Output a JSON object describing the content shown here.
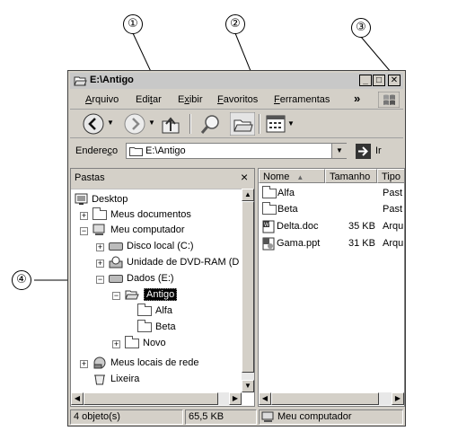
{
  "callouts": [
    "①",
    "②",
    "③",
    "④"
  ],
  "window": {
    "title": "E:\\Antigo",
    "controls": {
      "minimize": "_",
      "maximize": "□",
      "close": "✕"
    }
  },
  "menubar": {
    "items": [
      {
        "pre": "",
        "key": "A",
        "post": "rquivo"
      },
      {
        "pre": "Edi",
        "key": "t",
        "post": "ar"
      },
      {
        "pre": "E",
        "key": "x",
        "post": "ibir"
      },
      {
        "pre": "",
        "key": "F",
        "post": "avoritos"
      },
      {
        "pre": "",
        "key": "F",
        "post": "erramentas"
      }
    ],
    "overflow": "»"
  },
  "addressbar": {
    "label_pre": "Endere",
    "label_key": "ç",
    "label_post": "o",
    "value": "E:\\Antigo",
    "go": "Ir"
  },
  "tree": {
    "title": "Pastas",
    "close": "×",
    "items": [
      {
        "label": "Desktop",
        "icon": "desktop-icon"
      },
      {
        "label": "Meus documentos",
        "icon": "folder-icon",
        "toggle": "+"
      },
      {
        "label": "Meu computador",
        "icon": "computer-icon",
        "toggle": "−"
      },
      {
        "label": "Disco local (C:)",
        "icon": "drive-icon",
        "toggle": "+"
      },
      {
        "label": "Unidade de DVD-RAM (D",
        "icon": "dvd-icon",
        "toggle": "+"
      },
      {
        "label": "Dados (E:)",
        "icon": "drive-icon",
        "toggle": "−"
      },
      {
        "label": "Antigo",
        "icon": "folder-open-icon",
        "toggle": "−",
        "selected": true
      },
      {
        "label": "Alfa",
        "icon": "folder-icon"
      },
      {
        "label": "Beta",
        "icon": "folder-icon"
      },
      {
        "label": "Novo",
        "icon": "folder-icon",
        "toggle": "+"
      },
      {
        "label": "Meus locais de rede",
        "icon": "network-icon",
        "toggle": "+"
      },
      {
        "label": "Lixeira",
        "icon": "recycle-bin-icon"
      }
    ]
  },
  "files": {
    "columns": [
      "Nome",
      "Tamanho",
      "Tipo"
    ],
    "rows": [
      {
        "name": "Alfa",
        "size": "",
        "type": "Past",
        "icon": "folder-icon"
      },
      {
        "name": "Beta",
        "size": "",
        "type": "Past",
        "icon": "folder-icon"
      },
      {
        "name": "Delta.doc",
        "size": "35 KB",
        "type": "Arqu",
        "icon": "word-doc-icon"
      },
      {
        "name": "Gama.ppt",
        "size": "31 KB",
        "type": "Arqu",
        "icon": "ppt-icon"
      }
    ]
  },
  "status": {
    "objects": "4 objeto(s)",
    "size": "65,5 KB",
    "location": "Meu computador"
  }
}
